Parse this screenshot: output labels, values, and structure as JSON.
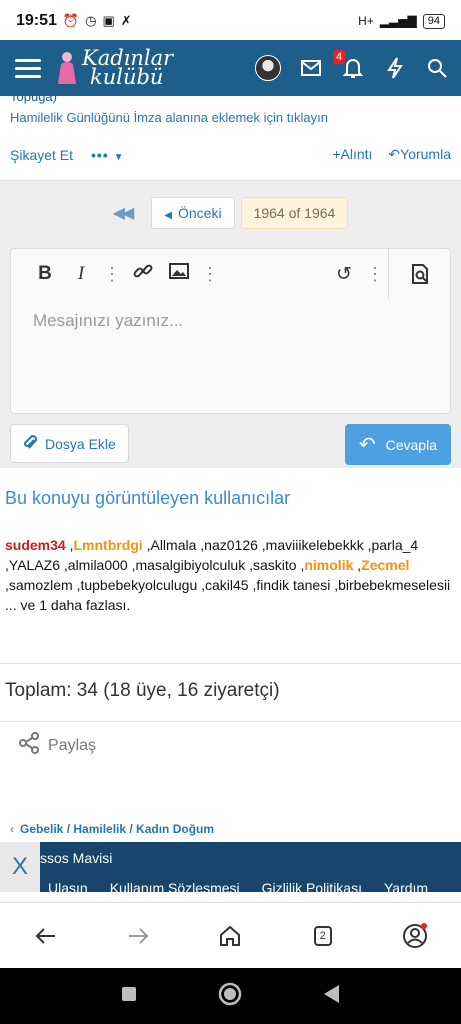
{
  "statusbar": {
    "time": "19:51",
    "network": "H+",
    "battery": "94"
  },
  "appbar": {
    "logo_line1": "Kadınlar",
    "logo_line2": "kulübü",
    "notif_count": "4"
  },
  "signature": {
    "cut_text": "Topuga)",
    "link_text": "Hamilelik Günlüğünü İmza alanına eklemek için tıklayın"
  },
  "post_actions": {
    "report": "Şikayet Et",
    "more": "•••",
    "quote": "Alıntı",
    "reply": "Yorumla"
  },
  "pager": {
    "prev": "Önceki",
    "current": "1964 of 1964"
  },
  "editor": {
    "placeholder": "Mesajınızı yazınız...",
    "attach": "Dosya Ekle",
    "submit": "Cevapla"
  },
  "viewers": {
    "title": "Bu konuyu görüntüleyen kullanıcılar",
    "users": [
      {
        "name": "sudem34",
        "color": "red"
      },
      {
        "name": "Lmntbrdgi",
        "color": "orange"
      },
      {
        "name": "Allmala",
        "color": "black"
      },
      {
        "name": "naz0126",
        "color": "black"
      },
      {
        "name": "maviiikelebekkk",
        "color": "black"
      },
      {
        "name": "parla_4",
        "color": "black"
      },
      {
        "name": "YALAZ6",
        "color": "black"
      },
      {
        "name": "almila000",
        "color": "black"
      },
      {
        "name": "masalgibiyolculuk",
        "color": "black"
      },
      {
        "name": "saskito",
        "color": "black"
      },
      {
        "name": "nimolik",
        "color": "orange"
      },
      {
        "name": "Zecmel",
        "color": "orange"
      },
      {
        "name": "samozlem",
        "color": "black"
      },
      {
        "name": "tupbebekyolculugu",
        "color": "black"
      },
      {
        "name": "cakil45",
        "color": "black"
      },
      {
        "name": "findik tanesi",
        "color": "black"
      },
      {
        "name": "birbebekmeselesii",
        "color": "black"
      }
    ],
    "more": "... ve 1 daha fazlası."
  },
  "total": "Toplam: 34 (18 üye, 16 ziyaretçi)",
  "share": "Paylaş",
  "breadcrumbs": [
    "Gebelik / Hamilelik / Kadın Doğum"
  ],
  "footer": {
    "style": "ssos Mavisi",
    "links": [
      "Ulaşın",
      "Kullanım Sözleşmesi",
      "Gizlilik Politikası",
      "Yardım"
    ],
    "close": "X"
  },
  "browser": {
    "tab_count": "2"
  },
  "colors": {
    "brand": "#1d5e8a",
    "link": "#2577b1",
    "accent_button": "#4ea1e0",
    "user_red": "#d11b1b",
    "user_orange": "#f0930f"
  }
}
